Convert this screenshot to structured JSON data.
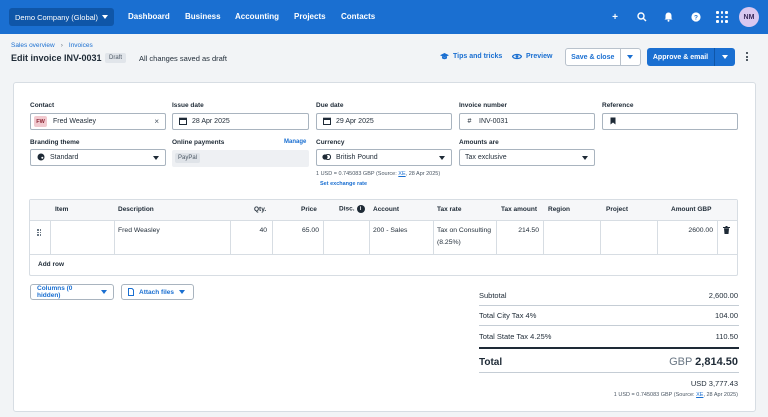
{
  "nav": {
    "org": "Demo Company (Global)",
    "links": [
      "Dashboard",
      "Business",
      "Accounting",
      "Projects",
      "Contacts"
    ],
    "avatar": "NM"
  },
  "header": {
    "breadcrumb": [
      "Sales overview",
      "Invoices"
    ],
    "title": "Edit invoice INV-0031",
    "badge": "Draft",
    "status": "All changes saved as draft",
    "tips": "Tips and tricks",
    "preview": "Preview",
    "save_close": "Save & close",
    "approve": "Approve & email"
  },
  "form": {
    "contact_label": "Contact",
    "contact_initials": "FW",
    "contact_value": "Fred Weasley",
    "issue_label": "Issue date",
    "issue_value": "28 Apr 2025",
    "due_label": "Due date",
    "due_value": "29 Apr 2025",
    "invnum_label": "Invoice number",
    "invnum_value": "INV-0031",
    "ref_label": "Reference",
    "ref_value": "",
    "branding_label": "Branding theme",
    "branding_value": "Standard",
    "payments_label": "Online payments",
    "manage": "Manage",
    "paypal": "PayPal",
    "currency_label": "Currency",
    "currency_value": "British Pound",
    "amounts_label": "Amounts are",
    "amounts_value": "Tax exclusive",
    "rate_pre": "1 USD = 0.745083 GBP (Source: ",
    "rate_src": "XE",
    "rate_post": ", 28 Apr 2025)",
    "set_rate": "Set exchange rate"
  },
  "table": {
    "headers": [
      "Item",
      "Description",
      "Qty.",
      "Price",
      "Disc.",
      "Account",
      "Tax rate",
      "Tax amount",
      "Region",
      "Project",
      "Amount GBP"
    ],
    "row": {
      "item": "",
      "description": "Fred Weasley",
      "qty": "40",
      "price": "65.00",
      "disc": "",
      "account": "200 - Sales",
      "taxrate_1": "Tax on Consulting",
      "taxrate_2": "(8.25%)",
      "taxamount": "214.50",
      "region": "",
      "project": "",
      "amount": "2600.00"
    },
    "add_row": "Add row"
  },
  "footer": {
    "columns_btn": "Columns (0 hidden)",
    "attach_btn": "Attach files",
    "subtotal_label": "Subtotal",
    "subtotal": "2,600.00",
    "city_label": "Total City Tax 4%",
    "city": "104.00",
    "state_label": "Total State Tax 4.25%",
    "state": "110.50",
    "total_label": "Total",
    "total_cur": "GBP",
    "total": "2,814.50",
    "usd": "USD 3,777.43",
    "rate_pre": "1 USD = 0.745083 GBP (Source: ",
    "rate_src": "XE",
    "rate_post": ", 28 Apr 2025)"
  },
  "colors": {
    "nav": "#1a6fd1",
    "accent": "#1a6fd1"
  }
}
